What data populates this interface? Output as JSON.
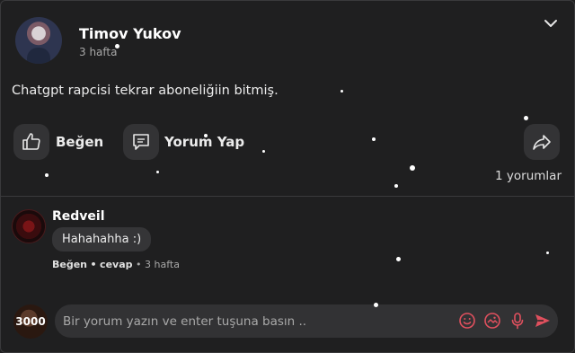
{
  "post": {
    "author": "Timov Yukov",
    "time": "3 hafta",
    "text": "Chatgpt rapcisi tekrar aboneliğiin bitmiş.",
    "actions": {
      "like": "Beğen",
      "comment": "Yorum Yap"
    },
    "comments_count": "1 yorumlar"
  },
  "comment": {
    "author": "Redveil",
    "text": "Hahahahha :)",
    "like": "Beğen",
    "reply": "cevap",
    "separator": "•",
    "time": "3 hafta"
  },
  "composer": {
    "avatar_text": "3000",
    "placeholder": "Bir yorum yazın ve enter tuşuna basın .."
  },
  "colors": {
    "background": "#1f1f20",
    "icon_red": "#e0505e"
  }
}
